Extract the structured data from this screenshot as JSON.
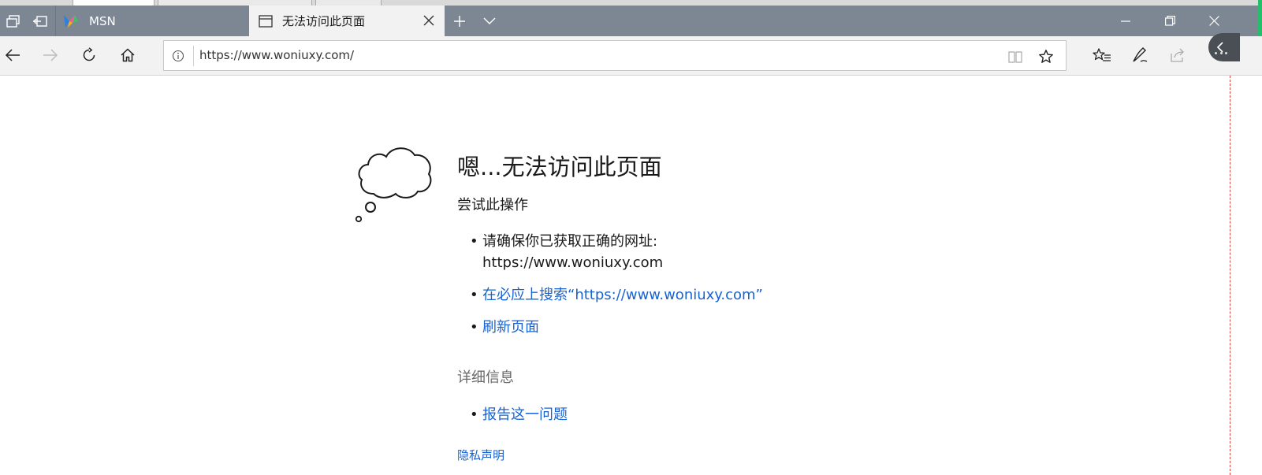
{
  "browser": {
    "tabs": [
      {
        "label": "MSN",
        "active": false
      },
      {
        "label": "无法访问此页面",
        "active": true
      }
    ],
    "address": {
      "url": "https://www.woniuxy.com/"
    },
    "colors": {
      "titlebar": "#7d8794",
      "navbar": "#f2f2f2",
      "accent": "#22c06a"
    }
  },
  "page": {
    "heading": "嗯...无法访问此页面",
    "try_title": "尝试此操作",
    "try_items": {
      "check_line1": "请确保你已获取正确的网址:",
      "check_line2": "https://www.woniuxy.com",
      "search_link": "在必应上搜索“https://www.woniuxy.com”",
      "refresh_link": "刷新页面"
    },
    "details_title": "详细信息",
    "report_link": "报告这一问题",
    "privacy_link": "隐私声明",
    "link_color": "#1862d1"
  },
  "icons": [
    "tab-list-icon",
    "set-aside-icon",
    "msn-icon",
    "page-icon",
    "close-icon",
    "plus-icon",
    "chevron-down-icon",
    "minimize-icon",
    "restore-icon",
    "window-close-icon",
    "back-icon",
    "forward-icon",
    "refresh-icon",
    "home-icon",
    "info-icon",
    "reading-view-icon",
    "star-icon",
    "favorites-icon",
    "pen-icon",
    "share-icon",
    "more-icon",
    "thought-cloud-icon"
  ]
}
